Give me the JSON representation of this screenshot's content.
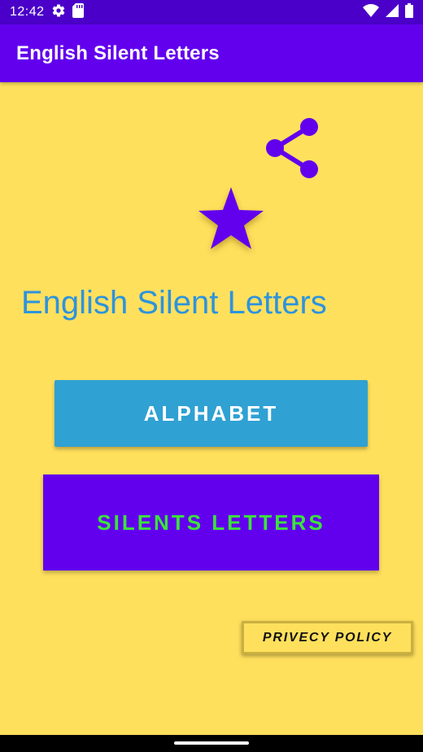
{
  "status_bar": {
    "time": "12:42",
    "left_icons": [
      "gear-icon",
      "sd-card-icon"
    ],
    "right_icons": [
      "wifi-icon",
      "cell-signal-icon",
      "battery-icon"
    ]
  },
  "app_bar": {
    "title": "English Silent Letters"
  },
  "main": {
    "share_icon": "share-icon",
    "star_icon": "star-icon",
    "title": "English Silent Letters",
    "alphabet_button": "ALPHABET",
    "silents_button": "SILENTS LETTERS",
    "privacy_button": "PRIVECY POLICY"
  },
  "colors": {
    "background": "#FFE05D",
    "app_bar": "#6200EE",
    "status_bar": "#4A00C8",
    "title_blue": "#2D93DD",
    "alphabet_button": "#2FA1D3",
    "silents_text": "#3BE33B"
  }
}
